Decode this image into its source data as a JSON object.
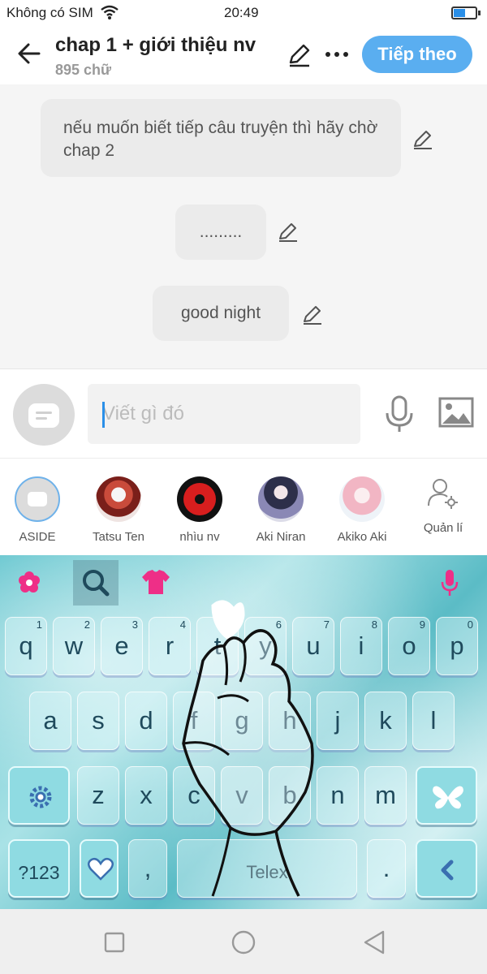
{
  "status_bar": {
    "carrier": "Không có SIM",
    "time": "20:49",
    "battery_level": 0.55
  },
  "header": {
    "title": "chap 1 + giới thiệu nv",
    "subtitle": "895 chữ",
    "next_label": "Tiếp theo"
  },
  "messages": [
    {
      "text": "nếu muốn biết tiếp câu truyện thì hãy chờ chap 2"
    },
    {
      "text": "........."
    },
    {
      "text": "good night"
    }
  ],
  "composer": {
    "placeholder": "Viết gì đó"
  },
  "characters": [
    {
      "name": "ASIDE"
    },
    {
      "name": "Tatsu Ten"
    },
    {
      "name": "nhìu nv"
    },
    {
      "name": "Aki Niran"
    },
    {
      "name": "Akiko Aki"
    }
  ],
  "manage_label": "Quản lí",
  "keyboard": {
    "row1": [
      {
        "ch": "q",
        "hint": "1"
      },
      {
        "ch": "w",
        "hint": "2"
      },
      {
        "ch": "e",
        "hint": "3"
      },
      {
        "ch": "r",
        "hint": "4"
      },
      {
        "ch": "t",
        "hint": "5"
      },
      {
        "ch": "y",
        "hint": "6"
      },
      {
        "ch": "u",
        "hint": "7"
      },
      {
        "ch": "i",
        "hint": "8"
      },
      {
        "ch": "o",
        "hint": "9"
      },
      {
        "ch": "p",
        "hint": "0"
      }
    ],
    "row2": [
      "a",
      "s",
      "d",
      "f",
      "g",
      "h",
      "j",
      "k",
      "l"
    ],
    "row3": [
      "z",
      "x",
      "c",
      "v",
      "b",
      "n",
      "m"
    ],
    "num_label": "?123",
    "comma": ",",
    "space_label": "Telex",
    "period": "."
  },
  "colors": {
    "accent": "#5aaef0",
    "bubble": "#ebebeb",
    "keyboard_theme": "#8fdbe2",
    "icon_pink": "#ee2f87"
  }
}
